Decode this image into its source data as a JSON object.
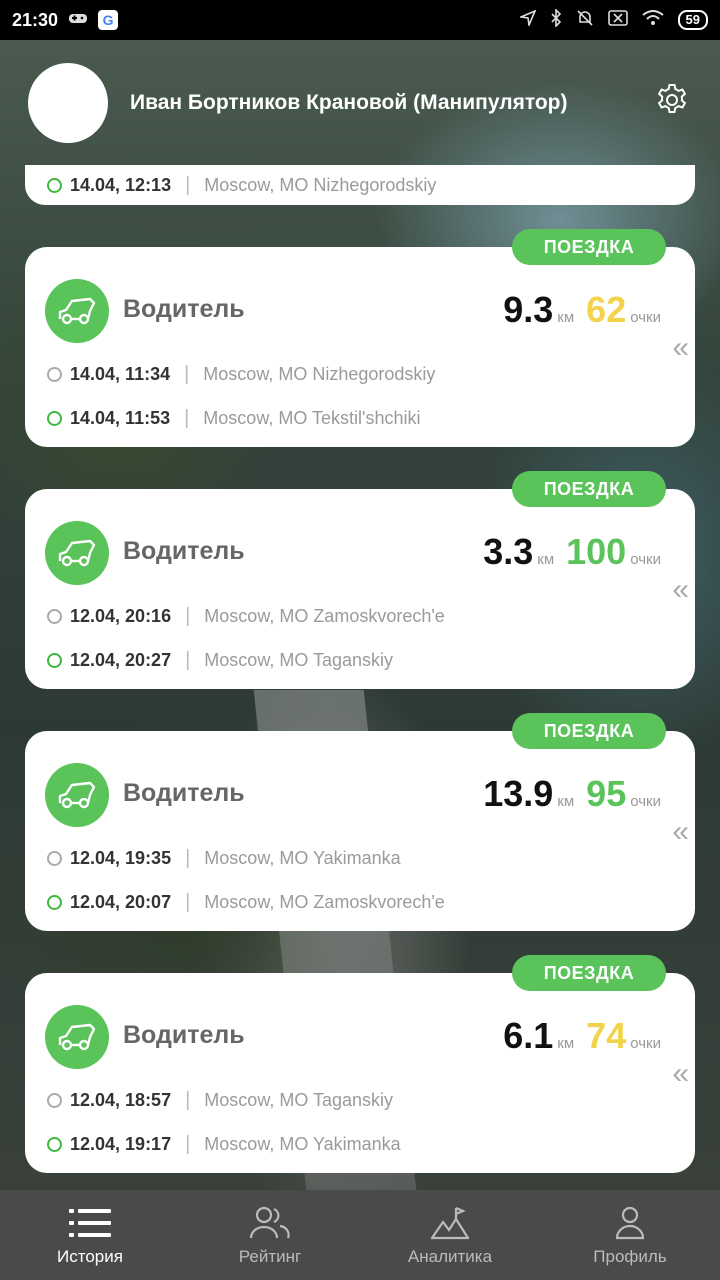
{
  "status_bar": {
    "time": "21:30",
    "battery": "59"
  },
  "header": {
    "user_name": "Иван Бортников Крановой (Манипулятор)"
  },
  "partial_trip": {
    "end_time": "14.04, 12:13",
    "end_address": "Moscow, MO Nizhegorodskiy"
  },
  "trips": [
    {
      "badge": "ПОЕЗДКА",
      "role": "Водитель",
      "km": "9.3",
      "km_unit": "км",
      "points": "62",
      "points_unit": "очки",
      "points_color": "yellow",
      "start_time": "14.04, 11:34",
      "start_address": "Moscow, MO Nizhegorodskiy",
      "end_time": "14.04, 11:53",
      "end_address": "Moscow, MO Tekstil'shchiki"
    },
    {
      "badge": "ПОЕЗДКА",
      "role": "Водитель",
      "km": "3.3",
      "km_unit": "км",
      "points": "100",
      "points_unit": "очки",
      "points_color": "green",
      "start_time": "12.04, 20:16",
      "start_address": "Moscow, MO Zamoskvorech'e",
      "end_time": "12.04, 20:27",
      "end_address": "Moscow, MO Taganskiy"
    },
    {
      "badge": "ПОЕЗДКА",
      "role": "Водитель",
      "km": "13.9",
      "km_unit": "км",
      "points": "95",
      "points_unit": "очки",
      "points_color": "green",
      "start_time": "12.04, 19:35",
      "start_address": "Moscow, MO Yakimanka",
      "end_time": "12.04, 20:07",
      "end_address": "Moscow, MO Zamoskvorech'e"
    },
    {
      "badge": "ПОЕЗДКА",
      "role": "Водитель",
      "km": "6.1",
      "km_unit": "км",
      "points": "74",
      "points_unit": "очки",
      "points_color": "yellow",
      "start_time": "12.04, 18:57",
      "start_address": "Moscow, MO Taganskiy",
      "end_time": "12.04, 19:17",
      "end_address": "Moscow, MO Yakimanka"
    }
  ],
  "bottom_nav": [
    {
      "label": "История",
      "icon": "list-icon",
      "active": true
    },
    {
      "label": "Рейтинг",
      "icon": "users-icon",
      "active": false
    },
    {
      "label": "Аналитика",
      "icon": "mountain-flag-icon",
      "active": false
    },
    {
      "label": "Профиль",
      "icon": "person-icon",
      "active": false
    }
  ],
  "colors": {
    "accent_green": "#5ac35a",
    "points_yellow": "#f2d34a",
    "nav_bg": "#4a4a4a"
  }
}
